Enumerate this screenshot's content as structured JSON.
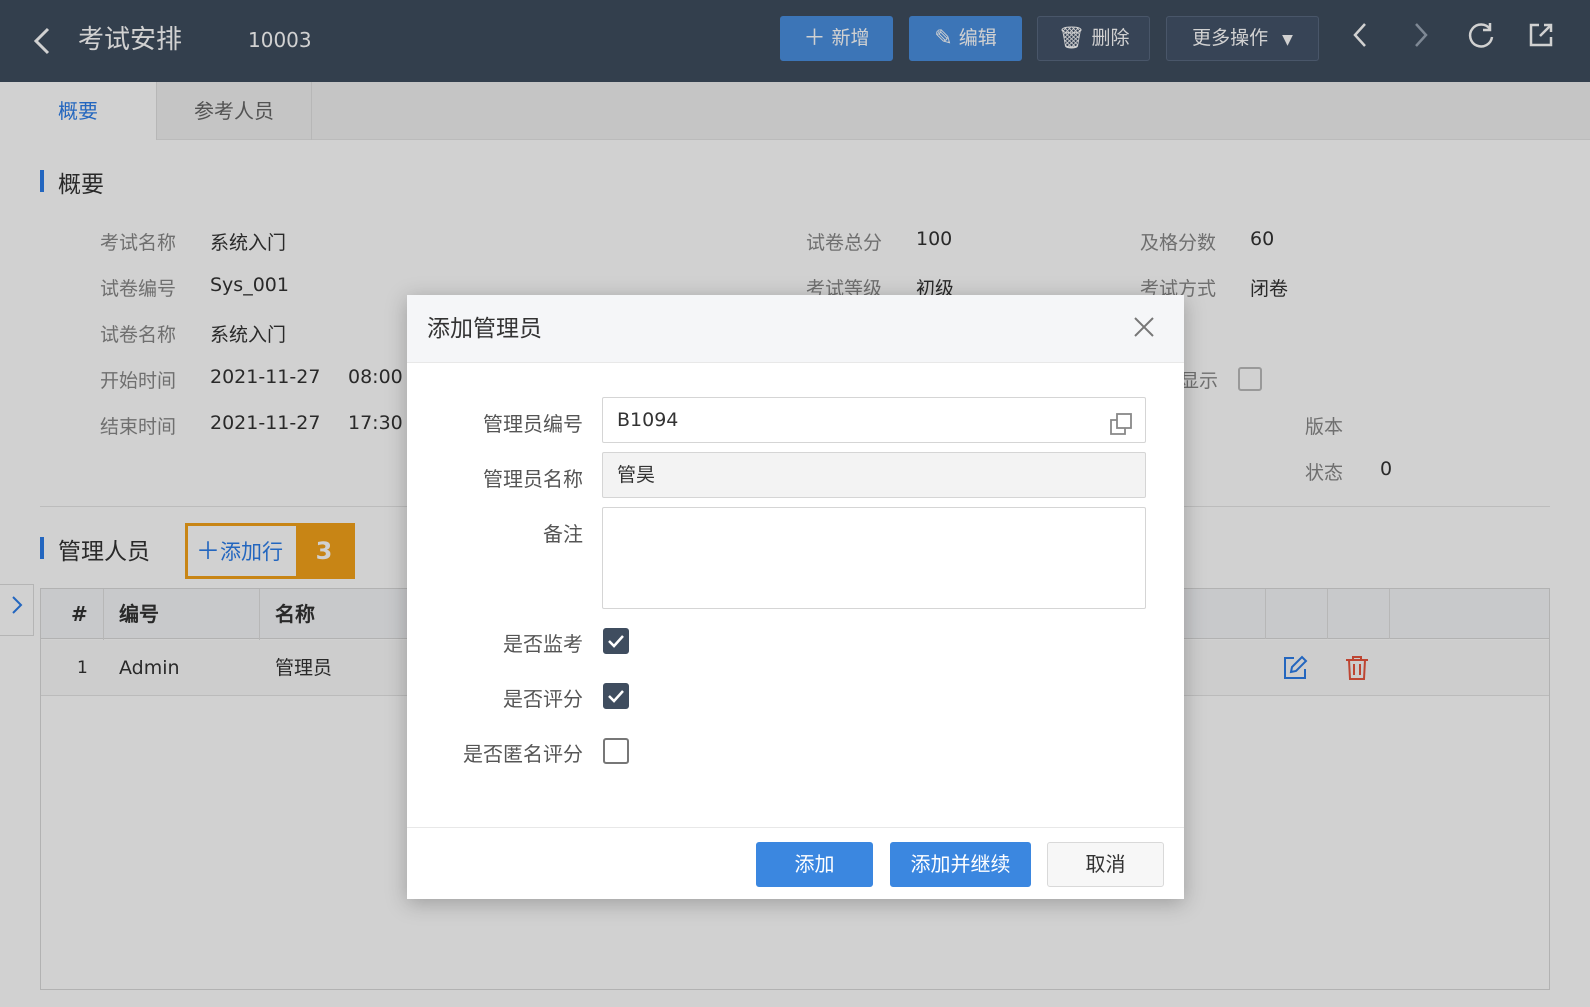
{
  "header": {
    "title": "考试安排",
    "record_code": "10003",
    "buttons": {
      "add": "新增",
      "edit": "编辑",
      "delete": "删除",
      "more": "更多操作"
    }
  },
  "tabs": [
    "概要",
    "参考人员"
  ],
  "overview": {
    "section_title": "概要",
    "fields": {
      "exam_name_label": "考试名称",
      "exam_name": "系统入门",
      "paper_no_label": "试卷编号",
      "paper_no": "Sys_001",
      "paper_name_label": "试卷名称",
      "paper_name": "系统入门",
      "start_label": "开始时间",
      "start_date": "2021-11-27",
      "start_time": "08:00",
      "end_label": "结束时间",
      "end_date": "2021-11-27",
      "end_time": "17:30",
      "total_score_label": "试卷总分",
      "total_score": "100",
      "pass_score_label": "及格分数",
      "pass_score": "60",
      "exam_level_label": "考试等级",
      "exam_level": "初级",
      "exam_mode_label": "考试方式",
      "exam_mode": "闭卷",
      "display_label_partial": "显示",
      "version_label": "版本",
      "status_label": "状态",
      "status": "0"
    }
  },
  "managers": {
    "section_title": "管理人员",
    "add_row_label": "添加行",
    "step_badge": "3",
    "columns": [
      "#",
      "编号",
      "名称"
    ],
    "rows": [
      {
        "index": "1",
        "code": "Admin",
        "name": "管理员"
      }
    ]
  },
  "dialog": {
    "title": "添加管理员",
    "fields": {
      "admin_no_label": "管理员编号",
      "admin_no": "B1094",
      "admin_name_label": "管理员名称",
      "admin_name": "管昊",
      "remark_label": "备注",
      "proctor_label": "是否监考",
      "grading_label": "是否评分",
      "anon_grading_label": "是否匿名评分"
    },
    "checks": {
      "proctor": true,
      "grading": true,
      "anon_grading": false
    },
    "buttons": {
      "add": "添加",
      "add_continue": "添加并继续",
      "cancel": "取消"
    }
  },
  "colors": {
    "header_bg": "#3f4d5f",
    "accent": "#2b7de9",
    "primary_button": "#3b87e0",
    "highlight": "#f5a31a",
    "delete_icon": "#e8553d"
  }
}
